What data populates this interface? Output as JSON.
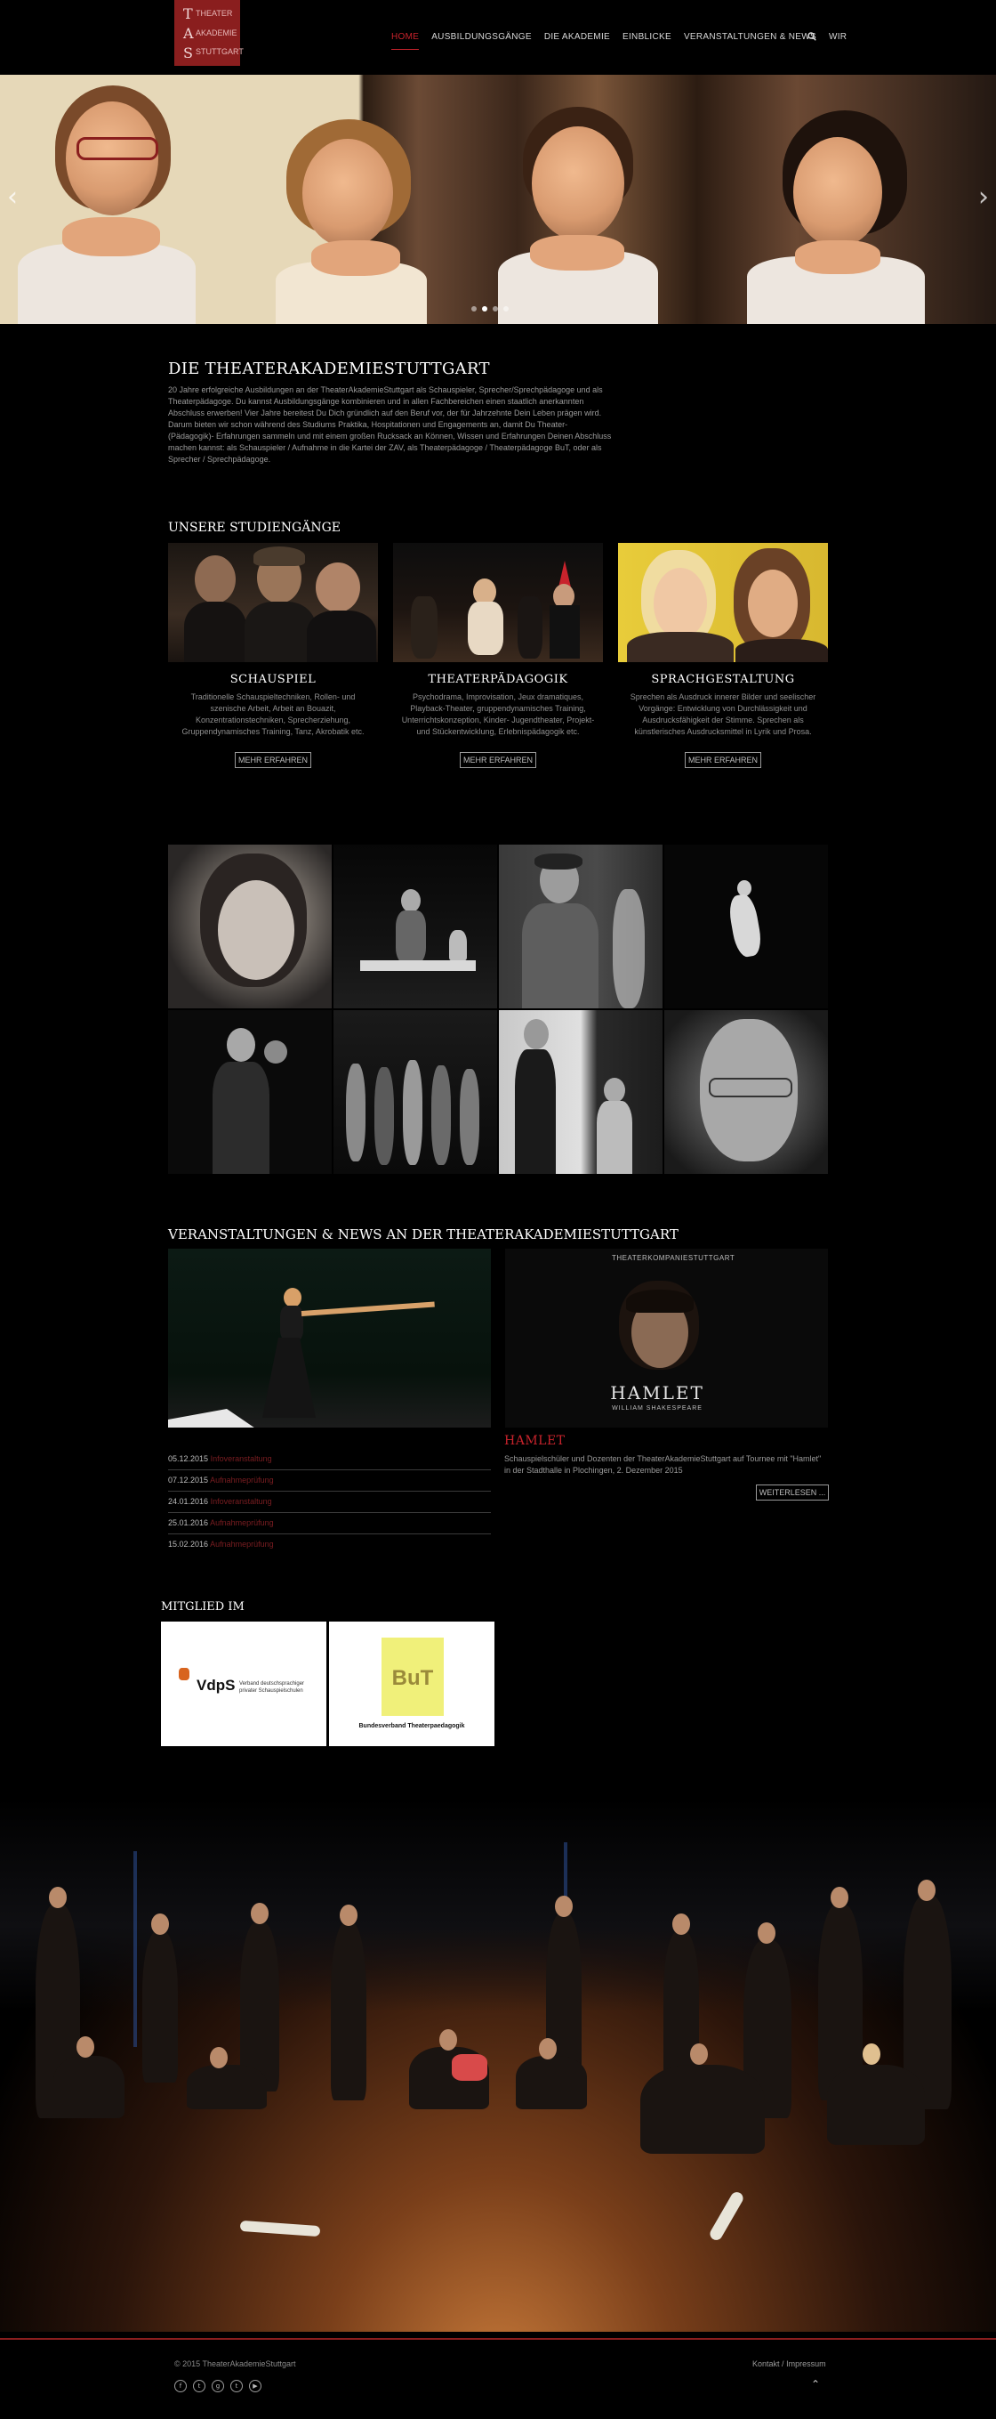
{
  "brand": {
    "logo_letters": [
      "T",
      "A",
      "S"
    ],
    "logo_words": [
      "THEATER",
      "AKADEMIE",
      "STUTTGART"
    ],
    "logo_color": "#8a1e1e"
  },
  "nav": {
    "items": [
      {
        "label": "HOME",
        "active": true
      },
      {
        "label": "AUSBILDUNGSGÄNGE"
      },
      {
        "label": "DIE AKADEMIE"
      },
      {
        "label": "EINBLICKE"
      },
      {
        "label": "VERANSTALTUNGEN & NEWS"
      },
      {
        "label": "WIR"
      }
    ],
    "search_icon": "search-icon",
    "accent_color": "#c8232c"
  },
  "slider": {
    "prev_icon": "chevron-left-icon",
    "next_icon": "chevron-right-icon",
    "dots": 4,
    "active_dot": 2
  },
  "intro": {
    "title": "DIE THEATERAKADEMIESTUTTGART",
    "text": "20 Jahre erfolgreiche Ausbildungen an der TheaterAkademieStuttgart als Schauspieler, Sprecher/Sprechpädagoge und als Theaterpädagoge. Du kannst Ausbildungsgänge kombinieren und in allen Fachbereichen einen staatlich anerkannten Abschluss erwerben! Vier Jahre bereitest Du Dich gründlich auf den Beruf vor, der für Jahrzehnte Dein Leben prägen wird. Darum bieten wir schon während des Studiums Praktika, Hospitationen und Engagements an, damit Du Theater-(Pädagogik)- Erfahrungen sammeln und mit einem großen Rucksack an Können, Wissen und Erfahrungen Deinen Abschluss machen kannst: als Schauspieler / Aufnahme in die Kartei der ZAV, als Theaterpädagoge / Theaterpädagoge BuT, oder als Sprecher / Sprechpädagoge."
  },
  "studies": {
    "title": "UNSERE STUDIENGÄNGE",
    "courses": [
      {
        "name": "SCHAUSPIEL",
        "desc": "Traditionelle Schauspieltechniken, Rollen- und szenische Arbeit, Arbeit an Bouazit, Konzentrationstechniken, Sprecherziehung, Gruppendynamisches Training, Tanz, Akrobatik etc.",
        "button": "MEHR ERFAHREN"
      },
      {
        "name": "THEATERPÄDAGOGIK",
        "desc": "Psychodrama, Improvisation, Jeux dramatiques, Playback-Theater, gruppendynamisches Training, Unterrichtskonzeption, Kinder- Jugendtheater, Projekt- und Stückentwicklung, Erlebnispädagogik etc.",
        "button": "MEHR ERFAHREN"
      },
      {
        "name": "SPRACHGESTALTUNG",
        "desc": "Sprechen als Ausdruck innerer Bilder und seelischer Vorgänge: Entwicklung von Durchlässigkeit und Ausdrucksfähigkeit der Stimme. Sprechen als künstlerisches Ausdrucksmittel in Lyrik und Prosa.",
        "button": "MEHR ERFAHREN"
      }
    ]
  },
  "events": {
    "title": "VERANSTALTUNGEN & NEWS AN DER THEATERAKADEMIESTUTTGART",
    "poster": {
      "company": "THEATERKOMPANIESTUTTGART",
      "play": "HAMLET",
      "author": "WILLIAM SHAKESPEARE"
    },
    "list": [
      {
        "date": "05.12.2015",
        "kind": "Infoveranstaltung"
      },
      {
        "date": "07.12.2015",
        "kind": "Aufnahmeprüfung"
      },
      {
        "date": "24.01.2016",
        "kind": "Infoveranstaltung"
      },
      {
        "date": "25.01.2016",
        "kind": "Aufnahmeprüfung"
      },
      {
        "date": "15.02.2016",
        "kind": "Aufnahmeprüfung"
      }
    ],
    "featured_title": "HAMLET",
    "featured_text": "Schauspielschüler und Dozenten der TheaterAkademieStuttgart auf Tournee mit \"Hamlet\" in der Stadthalle in Plochingen, 2. Dezember 2015",
    "more_button": "WEITERLESEN ..."
  },
  "members": {
    "title": "MITGLIED IM",
    "vdps": {
      "abbr": "VdpS",
      "line1": "Verband deutschsprachiger",
      "line2": "privater Schauspielschulen"
    },
    "but": {
      "abbr": "BuT",
      "caption": "Bundesverband Theaterpaedagogik",
      "color": "#f0f07a"
    }
  },
  "footer": {
    "copyright": "© 2015 TheaterAkademieStuttgart",
    "links": [
      "Kontakt",
      "Impressum"
    ],
    "separator": "/",
    "social_icons": [
      "facebook-icon",
      "twitter-icon",
      "google-plus-icon",
      "tumblr-icon",
      "youtube-icon"
    ],
    "social_glyphs": [
      "f",
      "t",
      "g",
      "t",
      "▶"
    ],
    "to_top_icon": "arrow-up-icon"
  }
}
